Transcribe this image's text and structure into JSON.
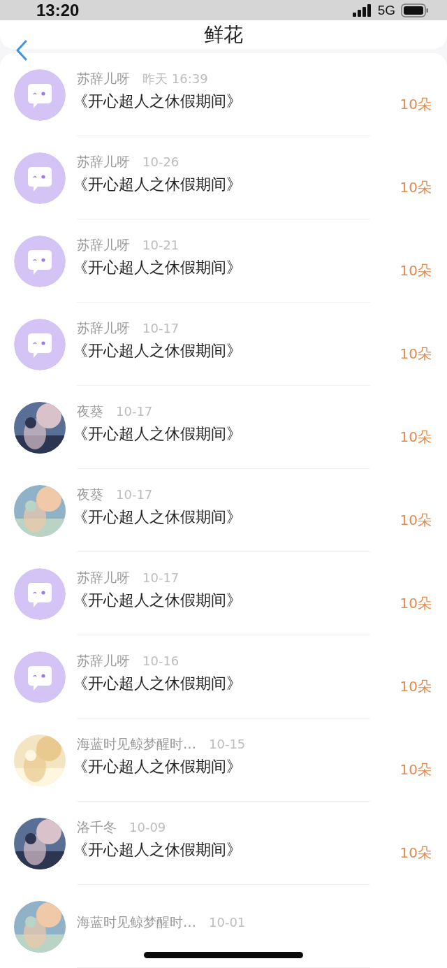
{
  "status_bar": {
    "time": "13:20",
    "network": "5G"
  },
  "header": {
    "title": "鲜花"
  },
  "gifts": [
    {
      "avatar": {
        "kind": "bot"
      },
      "name": "苏辞儿呀",
      "time": "昨天 16:39",
      "title": "《开心超人之休假期间》",
      "count": "10朵"
    },
    {
      "avatar": {
        "kind": "bot"
      },
      "name": "苏辞儿呀",
      "time": "10-26",
      "title": "《开心超人之休假期间》",
      "count": "10朵"
    },
    {
      "avatar": {
        "kind": "bot"
      },
      "name": "苏辞儿呀",
      "time": "10-21",
      "title": "《开心超人之休假期间》",
      "count": "10朵"
    },
    {
      "avatar": {
        "kind": "bot"
      },
      "name": "苏辞儿呀",
      "time": "10-17",
      "title": "《开心超人之休假期间》",
      "count": "10朵"
    },
    {
      "name": "夜葵",
      "time": "10-17",
      "title": "《开心超人之休假期间》",
      "count": "10朵"
    },
    {
      "name": "夜葵",
      "time": "10-17",
      "title": "《开心超人之休假期间》",
      "count": "10朵"
    },
    {
      "avatar": {
        "kind": "bot"
      },
      "name": "苏辞儿呀",
      "time": "10-17",
      "title": "《开心超人之休假期间》",
      "count": "10朵"
    },
    {
      "avatar": {
        "kind": "bot"
      },
      "name": "苏辞儿呀",
      "time": "10-16",
      "title": "《开心超人之休假期间》",
      "count": "10朵"
    },
    {
      "name": "海蓝时见鲸梦醒时…",
      "time": "10-15",
      "title": "《开心超人之休假期间》",
      "count": "10朵"
    },
    {
      "name": "洛千冬",
      "time": "10-09",
      "title": "《开心超人之休假期间》",
      "count": "10朵"
    },
    {
      "name": "海蓝时见鲸梦醒时…",
      "time": "10-01"
    }
  ]
}
